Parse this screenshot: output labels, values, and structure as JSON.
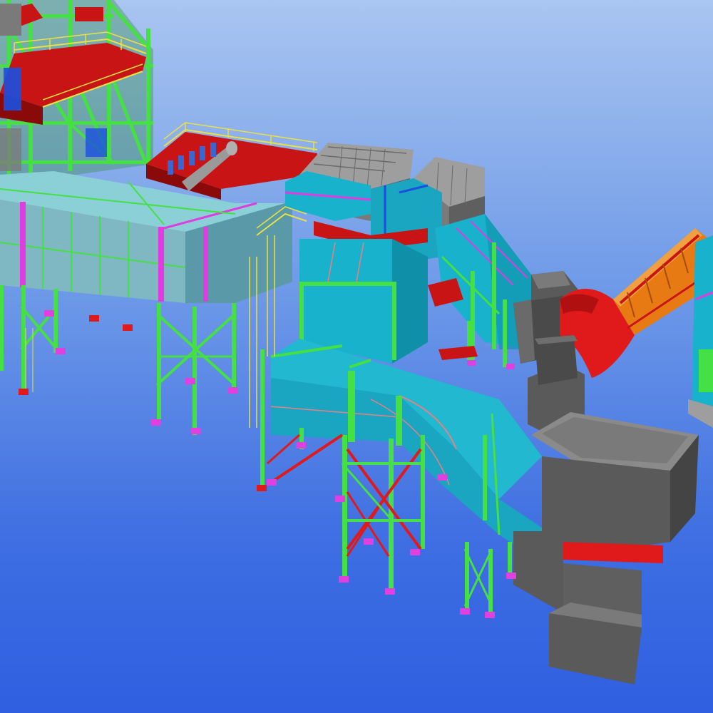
{
  "viewport": {
    "colors": {
      "sky_top": "#a9c5f0",
      "sky_bottom": "#2f5fe0",
      "steel": "#45e043",
      "bracing": "#e01a1a",
      "duct_cyan": "#19b2cc",
      "duct_light": "#8ad0d6",
      "duct_grey": "#5a5a5a",
      "panel_grey": "#8a8a8a",
      "platform_red": "#c81414",
      "railing": "#e8e045",
      "base_plate": "#e040e0",
      "chute_orange": "#e87a14",
      "stiffener_magenta": "#e03ce0",
      "accent_blue": "#1a4fe0"
    }
  }
}
